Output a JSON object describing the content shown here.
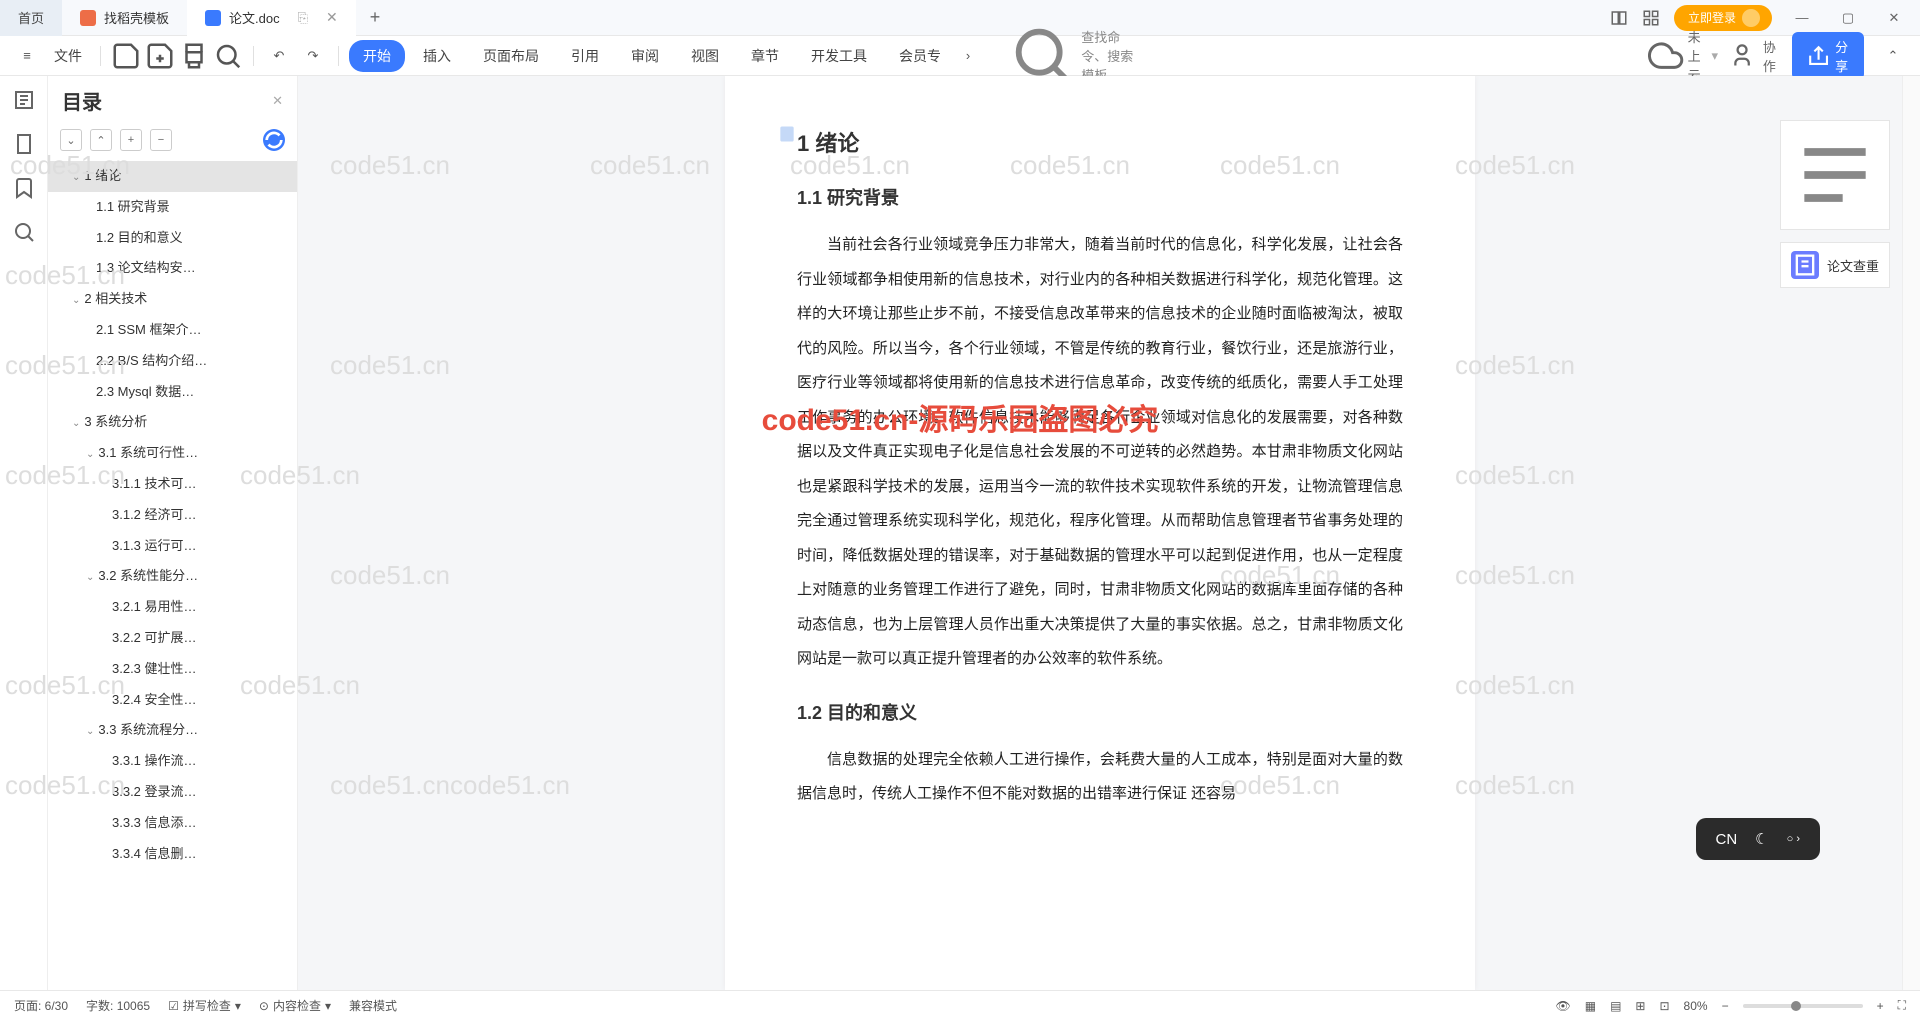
{
  "tabs": {
    "home": "首页",
    "tpl": "找稻壳模板",
    "doc": "论文.doc",
    "add": "+"
  },
  "login_label": "立即登录",
  "ribbon": {
    "file": "文件",
    "tabs": [
      "开始",
      "插入",
      "页面布局",
      "引用",
      "审阅",
      "视图",
      "章节",
      "开发工具",
      "会员专"
    ],
    "search_placeholder": "查找命令、搜索模板",
    "cloud": "未上云",
    "collab": "协作",
    "share": "分享"
  },
  "toc": {
    "title": "目录",
    "items": [
      {
        "t": "1  绪论",
        "pad": 24,
        "sel": true,
        "chev": "⌄"
      },
      {
        "t": "1.1  研究背景",
        "pad": 48
      },
      {
        "t": "1.2  目的和意义",
        "pad": 48
      },
      {
        "t": "1.3  论文结构安…",
        "pad": 48
      },
      {
        "t": "2  相关技术",
        "pad": 24,
        "chev": "⌄"
      },
      {
        "t": "2.1  SSM 框架介…",
        "pad": 48
      },
      {
        "t": "2.2  B/S 结构介绍…",
        "pad": 48
      },
      {
        "t": "2.3  Mysql 数据…",
        "pad": 48
      },
      {
        "t": "3  系统分析",
        "pad": 24,
        "chev": "⌄"
      },
      {
        "t": "3.1  系统可行性…",
        "pad": 38,
        "chev": "⌄"
      },
      {
        "t": "3.1.1  技术可…",
        "pad": 64
      },
      {
        "t": "3.1.2  经济可…",
        "pad": 64
      },
      {
        "t": "3.1.3  运行可…",
        "pad": 64
      },
      {
        "t": "3.2  系统性能分…",
        "pad": 38,
        "chev": "⌄"
      },
      {
        "t": "3.2.1  易用性…",
        "pad": 64
      },
      {
        "t": "3.2.2  可扩展…",
        "pad": 64
      },
      {
        "t": "3.2.3  健壮性…",
        "pad": 64
      },
      {
        "t": "3.2.4  安全性…",
        "pad": 64
      },
      {
        "t": "3.3  系统流程分…",
        "pad": 38,
        "chev": "⌄"
      },
      {
        "t": "3.3.1  操作流…",
        "pad": 64
      },
      {
        "t": "3.3.2  登录流…",
        "pad": 64
      },
      {
        "t": "3.3.3  信息添…",
        "pad": 64
      },
      {
        "t": "3.3.4  信息删…",
        "pad": 64
      }
    ]
  },
  "doc": {
    "h1": "1  绪论",
    "h2a": "1.1  研究背景",
    "p1": "当前社会各行业领域竞争压力非常大，随着当前时代的信息化，科学化发展，让社会各行业领域都争相使用新的信息技术，对行业内的各种相关数据进行科学化，规范化管理。这样的大环境让那些止步不前，不接受信息改革带来的信息技术的企业随时面临被淘汰，被取代的风险。所以当今，各个行业领域，不管是传统的教育行业，餐饮行业，还是旅游行业，医疗行业等领域都将使用新的信息技术进行信息革命，改变传统的纸质化，需要人手工处理工作事务的办公环境。软件信息技术能够满足各行企业领域对信息化的发展需要，对各种数据以及文件真正实现电子化是信息社会发展的不可逆转的必然趋势。本甘肃非物质文化网站也是紧跟科学技术的发展，运用当今一流的软件技术实现软件系统的开发，让物流管理信息完全通过管理系统实现科学化，规范化，程序化管理。从而帮助信息管理者节省事务处理的时间，降低数据处理的错误率，对于基础数据的管理水平可以起到促进作用，也从一定程度上对随意的业务管理工作进行了避免，同时，甘肃非物质文化网站的数据库里面存储的各种动态信息，也为上层管理人员作出重大决策提供了大量的事实依据。总之，甘肃非物质文化网站是一款可以真正提升管理者的办公效率的软件系统。",
    "h2b": "1.2  目的和意义",
    "p2": "信息数据的处理完全依赖人工进行操作，会耗费大量的人工成本，特别是面对大量的数据信息时，传统人工操作不但不能对数据的出错率进行保证  还容易"
  },
  "right_float": {
    "check": "论文查重"
  },
  "status": {
    "page": "页面: 6/30",
    "words": "字数: 10065",
    "spell": "拼写检查",
    "content": "内容检查",
    "compat": "兼容模式",
    "zoom": "80%"
  },
  "ime": {
    "lang": "CN"
  },
  "watermark_text": "code51.cn",
  "watermark_red": "code51.cn-源码乐园盗图必究"
}
